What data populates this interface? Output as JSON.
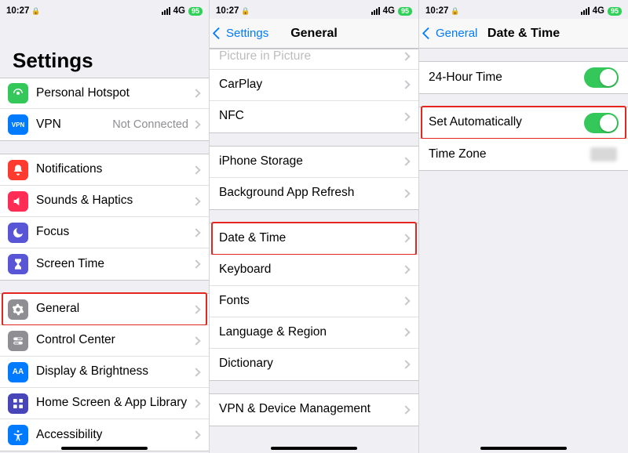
{
  "status": {
    "time": "10:27",
    "network": "4G",
    "battery": "95"
  },
  "screen1": {
    "title": "Settings",
    "group1": [
      {
        "icon": "hotspot",
        "bg": "#34c759",
        "label": "Personal Hotspot"
      },
      {
        "icon": "vpn",
        "bg": "#007aff",
        "label": "VPN",
        "value": "Not Connected"
      }
    ],
    "group2": [
      {
        "icon": "bell",
        "bg": "#ff3b30",
        "label": "Notifications"
      },
      {
        "icon": "speaker",
        "bg": "#ff2d55",
        "label": "Sounds & Haptics"
      },
      {
        "icon": "moon",
        "bg": "#5856d6",
        "label": "Focus"
      },
      {
        "icon": "hourglass",
        "bg": "#5856d6",
        "label": "Screen Time"
      }
    ],
    "group3": [
      {
        "icon": "gear",
        "bg": "#8e8e93",
        "label": "General",
        "highlight": true
      },
      {
        "icon": "switches",
        "bg": "#8e8e93",
        "label": "Control Center"
      },
      {
        "icon": "brightness",
        "bg": "#007aff",
        "label": "Display & Brightness"
      },
      {
        "icon": "grid",
        "bg": "#5155c0",
        "label": "Home Screen & App Library"
      },
      {
        "icon": "accessibility",
        "bg": "#007aff",
        "label": "Accessibility"
      }
    ]
  },
  "screen2": {
    "back": "Settings",
    "title": "General",
    "group0": [
      {
        "label": "Picture in Picture",
        "clipped": true
      },
      {
        "label": "CarPlay"
      },
      {
        "label": "NFC"
      }
    ],
    "group1": [
      {
        "label": "iPhone Storage"
      },
      {
        "label": "Background App Refresh"
      }
    ],
    "group2": [
      {
        "label": "Date & Time",
        "highlight": true
      },
      {
        "label": "Keyboard"
      },
      {
        "label": "Fonts"
      },
      {
        "label": "Language & Region"
      },
      {
        "label": "Dictionary"
      }
    ],
    "group3": [
      {
        "label": "VPN & Device Management"
      }
    ]
  },
  "screen3": {
    "back": "General",
    "title": "Date & Time",
    "group1": [
      {
        "label": "24-Hour Time",
        "switch": true
      }
    ],
    "group2": [
      {
        "label": "Set Automatically",
        "switch": true,
        "highlight": true
      },
      {
        "label": "Time Zone",
        "blur": true
      }
    ]
  }
}
